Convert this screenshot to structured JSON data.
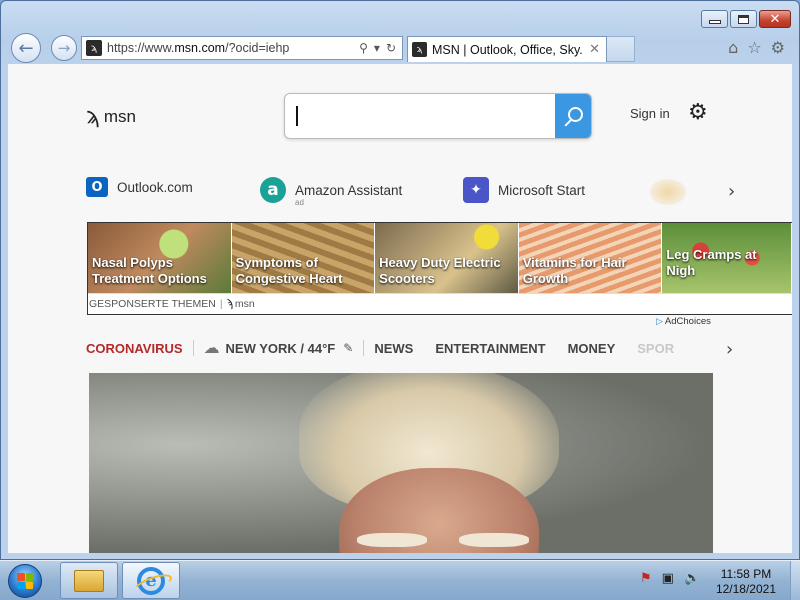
{
  "browser": {
    "address_url": "https://www.msn.com/?ocid=iehp",
    "address_prefix": "https://www.",
    "address_domain": "msn.com",
    "address_suffix": "/?ocid=iehp",
    "tab_title": "MSN | Outlook, Office, Sky..."
  },
  "header": {
    "logo_text": "msn",
    "search_value": "",
    "sign_in": "Sign in"
  },
  "quick_links": [
    {
      "label": "Outlook.com",
      "icon": "outlook-icon",
      "color": "#0a64c0"
    },
    {
      "label": "Amazon Assistant",
      "sub": "ad",
      "icon": "amazon-assistant-icon",
      "color": "#1aa198"
    },
    {
      "label": "Microsoft Start",
      "icon": "microsoft-start-icon",
      "color": "#4a56c7"
    }
  ],
  "sponsored": {
    "tiles": [
      {
        "label": "Nasal Polyps Treatment Options"
      },
      {
        "label": "Symptoms of Congestive Heart"
      },
      {
        "label": "Heavy Duty Electric Scooters"
      },
      {
        "label": "Vitamins for Hair Growth"
      },
      {
        "label": "Leg Cramps at Nigh"
      }
    ],
    "footer_text": "GESPONSERTE THEMEN",
    "footer_brand": "msn",
    "adchoices": "AdChoices"
  },
  "category_nav": {
    "coronavirus": "CORONAVIRUS",
    "weather": "NEW YORK / 44°F",
    "items": [
      "NEWS",
      "ENTERTAINMENT",
      "MONEY",
      "SPOR"
    ]
  },
  "taskbar": {
    "time": "11:58 PM",
    "date": "12/18/2021"
  },
  "colors": {
    "accent": "#3b97e2",
    "coronavirus": "#b22a2a"
  }
}
